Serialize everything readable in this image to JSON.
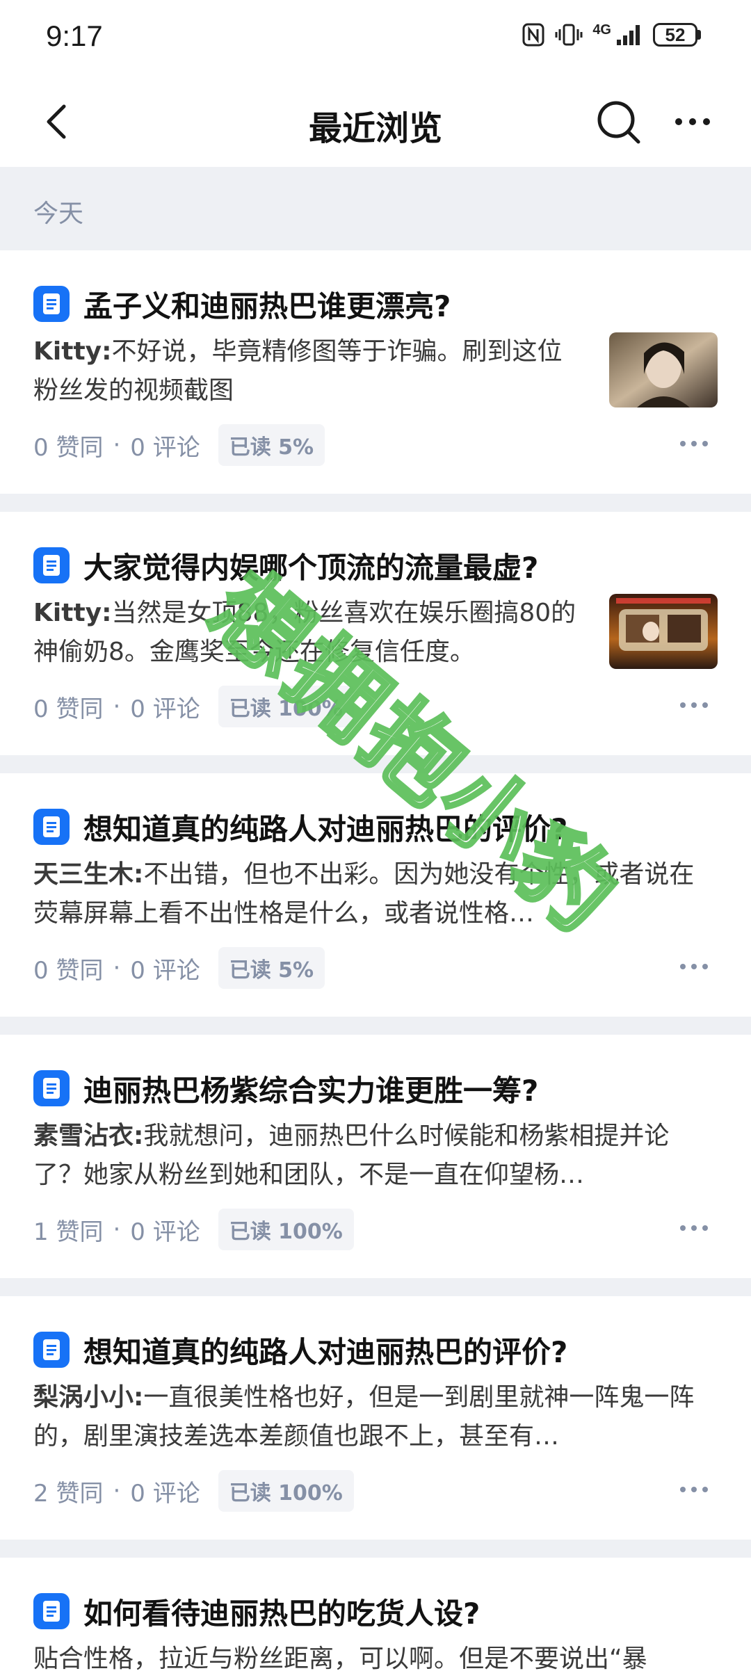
{
  "status_bar": {
    "time": "9:17",
    "network": "4G",
    "battery": "52"
  },
  "nav": {
    "title": "最近浏览"
  },
  "section": {
    "label": "今天"
  },
  "cards": [
    {
      "title": "孟子义和迪丽热巴谁更漂亮?",
      "author": "Kitty:",
      "excerpt": "不好说，毕竟精修图等于诈骗。刷到这位粉丝发的视频截图",
      "likes": "0 赞同",
      "comments": "0 评论",
      "read": "已读 5%"
    },
    {
      "title": "大家觉得内娱哪个顶流的流量最虚?",
      "author": "Kitty:",
      "excerpt": "当然是女顶88，粉丝喜欢在娱乐圈搞80的神偷奶8。金鹰奖至今还在修复信任度。",
      "likes": "0 赞同",
      "comments": "0 评论",
      "read": "已读 100%"
    },
    {
      "title": "想知道真的纯路人对迪丽热巴的评价?",
      "author": "天三生木:",
      "excerpt": "不出错，但也不出彩。因为她没有个性，或者说在荧幕屏幕上看不出性格是什么，或者说性格…",
      "likes": "0 赞同",
      "comments": "0 评论",
      "read": "已读 5%"
    },
    {
      "title": "迪丽热巴杨紫综合实力谁更胜一筹?",
      "author": "素雪沾衣:",
      "excerpt": "我就想问，迪丽热巴什么时候能和杨紫相提并论了？她家从粉丝到她和团队，不是一直在仰望杨…",
      "likes": "1 赞同",
      "comments": "0 评论",
      "read": "已读 100%"
    },
    {
      "title": "想知道真的纯路人对迪丽热巴的评价?",
      "author": "梨涡小小:",
      "excerpt": "一直很美性格也好，但是一到剧里就神一阵鬼一阵的，剧里演技差选本差颜值也跟不上，甚至有…",
      "likes": "2 赞同",
      "comments": "0 评论",
      "read": "已读 100%"
    },
    {
      "title": "如何看待迪丽热巴的吃货人设?",
      "author": "",
      "excerpt": "贴合性格，拉近与粉丝距离，可以啊。但是不要说出“暴",
      "likes": "",
      "comments": "",
      "read": ""
    }
  ],
  "watermark": {
    "text": "想拥抱小豹"
  },
  "colors": {
    "accent": "#1772f6",
    "muted_text": "#8590a6",
    "page_bg": "#eef0f4",
    "watermark": "#5cbf5a"
  }
}
